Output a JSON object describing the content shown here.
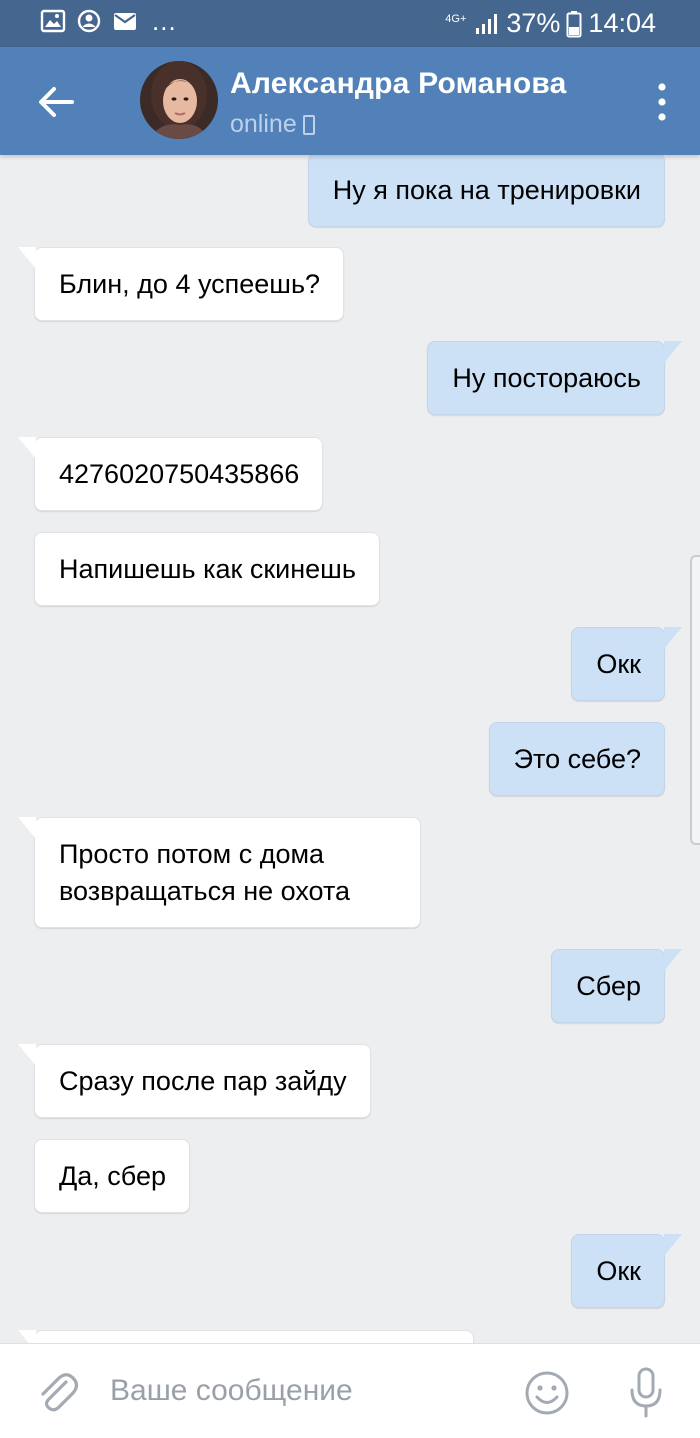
{
  "status_bar": {
    "notification_icons": [
      "gallery-icon",
      "alarm-icon",
      "mail-icon"
    ],
    "more_indicator": "...",
    "network": "4G+",
    "battery": "37%",
    "time": "14:04"
  },
  "header": {
    "contact_name": "Александра Романова",
    "status": "online",
    "icons": [
      "back-arrow-icon",
      "avatar",
      "mobile-icon",
      "more-vertical-icon"
    ]
  },
  "messages": [
    {
      "direction": "out",
      "text": "Ну я пока на тренировки"
    },
    {
      "direction": "in",
      "text": "Блин, до 4 успеешь?"
    },
    {
      "direction": "out",
      "text": "Ну постораюсь"
    },
    {
      "direction": "in",
      "text": "4276020750435866"
    },
    {
      "direction": "in",
      "text": "Напишешь как скинешь"
    },
    {
      "direction": "out",
      "text": "Окк"
    },
    {
      "direction": "out",
      "text": "Это себе?"
    },
    {
      "direction": "in",
      "text": "Просто потом с дома возвращаться не охота"
    },
    {
      "direction": "out",
      "text": "Сбер"
    },
    {
      "direction": "in",
      "text": "Сразу после пар зайду"
    },
    {
      "direction": "in",
      "text": "Да, сбер"
    },
    {
      "direction": "out",
      "text": "Окк"
    }
  ],
  "composer": {
    "placeholder": "Ваше сообщение",
    "value": "",
    "icons": [
      "attach-icon",
      "emoji-icon",
      "microphone-icon"
    ]
  },
  "colors": {
    "status_bar": "#45668e",
    "header": "#5181b8",
    "chat_background": "#edeef0",
    "incoming_bubble": "#ffffff",
    "outgoing_bubble": "#cce0f6"
  }
}
